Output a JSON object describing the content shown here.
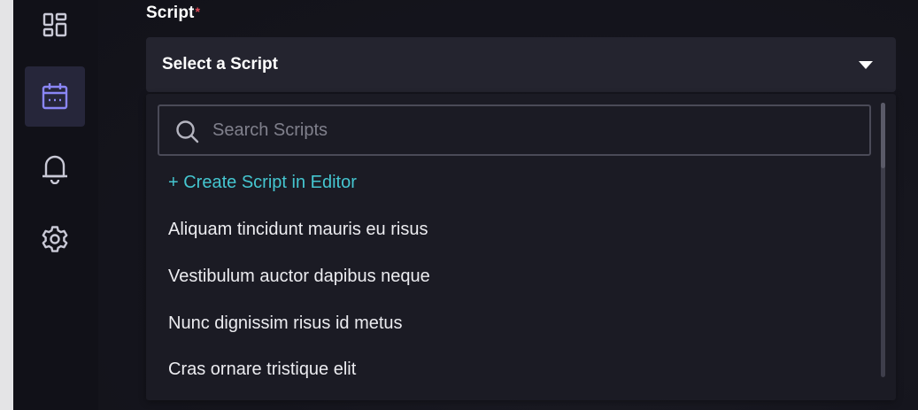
{
  "sidebar": {
    "items": [
      {
        "icon": "dashboard-icon",
        "active": false
      },
      {
        "icon": "calendar-icon",
        "active": true
      },
      {
        "icon": "bell-icon",
        "active": false
      },
      {
        "icon": "gear-icon",
        "active": false
      }
    ]
  },
  "form": {
    "label": "Script",
    "required_marker": "*",
    "select_value": "Select a Script"
  },
  "dropdown": {
    "search_placeholder": "Search Scripts",
    "create_link": "+ Create Script in Editor",
    "items": [
      "Aliquam tincidunt mauris eu risus",
      "Vestibulum auctor dapibus neque",
      "Nunc dignissim risus id metus",
      "Cras ornare tristique elit"
    ]
  },
  "colors": {
    "accent": "#8a86f5",
    "link": "#45c6d0",
    "required": "#e04b58",
    "sidebar_icon": "#c9c9d6"
  }
}
